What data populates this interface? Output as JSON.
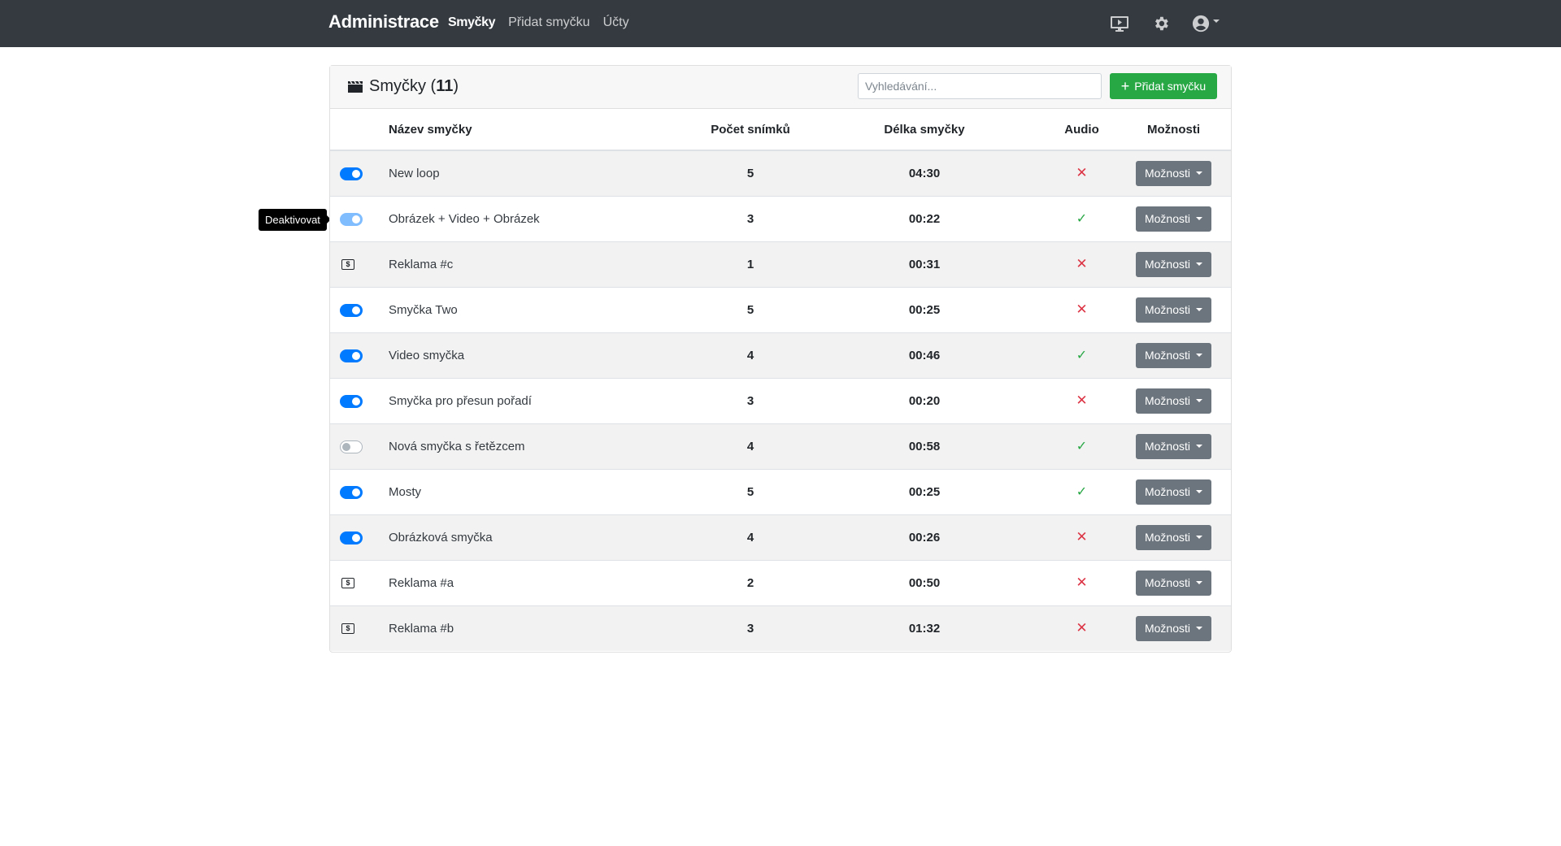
{
  "navbar": {
    "brand": "Administrace",
    "links": [
      {
        "label": "Smyčky",
        "active": true
      },
      {
        "label": "Přidat smyčku",
        "active": false
      },
      {
        "label": "Účty",
        "active": false
      }
    ],
    "icons": [
      "display-icon",
      "gear-icon",
      "user-circle-icon"
    ]
  },
  "card": {
    "title": "Smyčky",
    "count": "11",
    "search_placeholder": "Vyhledávání...",
    "add_button": "Přidat smyčku"
  },
  "table": {
    "headers": {
      "name": "Název smyčky",
      "slides": "Počet snímků",
      "length": "Délka smyčky",
      "audio": "Audio",
      "options": "Možnosti"
    },
    "rows": [
      {
        "state": "on",
        "name": "New loop",
        "slides": "5",
        "length": "04:30",
        "audio": false,
        "options": "Možnosti"
      },
      {
        "state": "hover",
        "name": "Obrázek + Video + Obrázek",
        "slides": "3",
        "length": "00:22",
        "audio": true,
        "options": "Možnosti"
      },
      {
        "state": "ad",
        "name": "Reklama #c",
        "slides": "1",
        "length": "00:31",
        "audio": false,
        "options": "Možnosti"
      },
      {
        "state": "on",
        "name": "Smyčka Two",
        "slides": "5",
        "length": "00:25",
        "audio": false,
        "options": "Možnosti"
      },
      {
        "state": "on",
        "name": "Video smyčka",
        "slides": "4",
        "length": "00:46",
        "audio": true,
        "options": "Možnosti"
      },
      {
        "state": "on",
        "name": "Smyčka pro přesun pořadí",
        "slides": "3",
        "length": "00:20",
        "audio": false,
        "options": "Možnosti"
      },
      {
        "state": "off",
        "name": "Nová smyčka s řetězcem",
        "slides": "4",
        "length": "00:58",
        "audio": true,
        "options": "Možnosti"
      },
      {
        "state": "on",
        "name": "Mosty",
        "slides": "5",
        "length": "00:25",
        "audio": true,
        "options": "Možnosti"
      },
      {
        "state": "on",
        "name": "Obrázková smyčka",
        "slides": "4",
        "length": "00:26",
        "audio": false,
        "options": "Možnosti"
      },
      {
        "state": "ad",
        "name": "Reklama #a",
        "slides": "2",
        "length": "00:50",
        "audio": false,
        "options": "Možnosti"
      },
      {
        "state": "ad",
        "name": "Reklama #b",
        "slides": "3",
        "length": "01:32",
        "audio": false,
        "options": "Možnosti"
      }
    ]
  },
  "ad_icon_label": "$",
  "tooltip": "Deaktivovat",
  "colors": {
    "navbar": "#343a40",
    "primary": "#007bff",
    "success": "#28a745",
    "danger": "#dc3545",
    "secondary": "#6c757d"
  }
}
